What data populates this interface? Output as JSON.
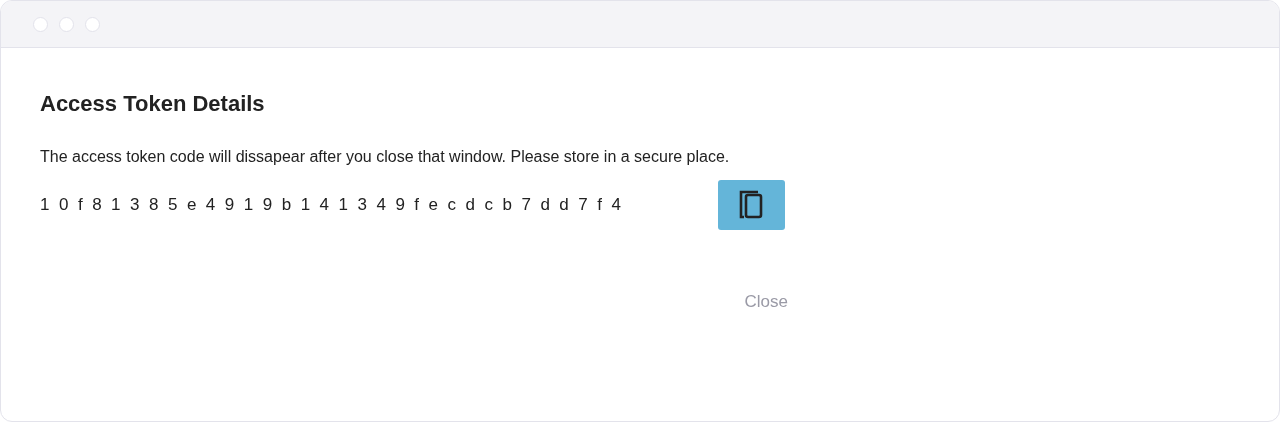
{
  "dialog": {
    "title": "Access Token Details",
    "message": "The access token code will dissapear after you close that window. Please store in a secure place.",
    "token": "10f81385e4919b141349fecdcb7dd7f4",
    "close_button": {
      "label": "Close",
      "disabled": true
    }
  }
}
